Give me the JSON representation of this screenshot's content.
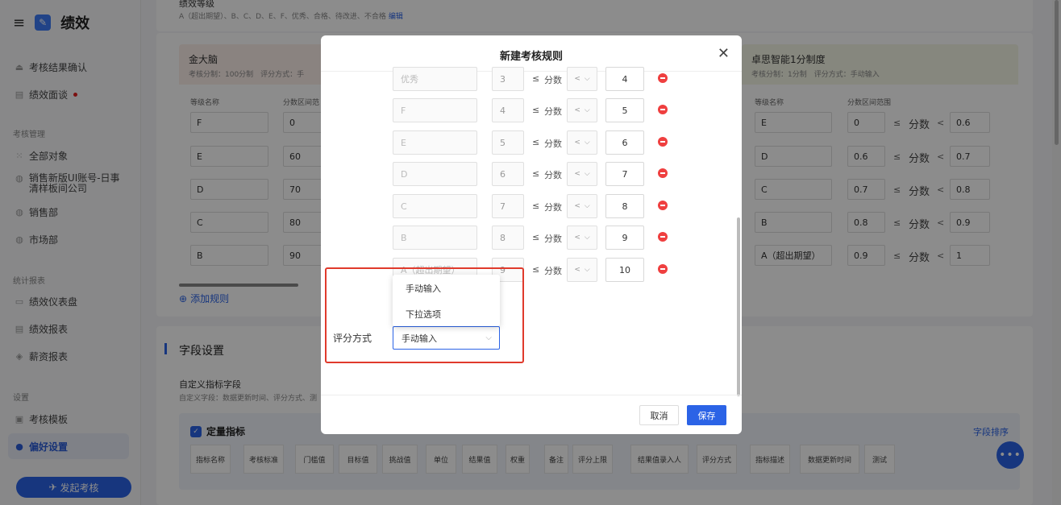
{
  "app": {
    "title": "绩效"
  },
  "sidebar": {
    "items": [
      {
        "label": "考核结果确认",
        "icon": "upload-icon"
      },
      {
        "label": "绩效面谈",
        "icon": "chat-icon"
      }
    ],
    "sections": {
      "manage": "考核管理",
      "stats": "统计报表",
      "settings": "设置"
    },
    "manage_items": [
      {
        "label": "全部对象"
      },
      {
        "label": "销售新版UI账号-日事清样板间公司"
      },
      {
        "label": "销售部"
      },
      {
        "label": "市场部"
      }
    ],
    "stats_items": [
      {
        "label": "绩效仪表盘"
      },
      {
        "label": "绩效报表"
      },
      {
        "label": "薪资报表"
      }
    ],
    "settings_items": [
      {
        "label": "考核模板"
      },
      {
        "label": "偏好设置"
      }
    ],
    "launch_button": "发起考核"
  },
  "background": {
    "grade_title": "绩效等级",
    "grade_sub": "A（超出期望）、B、C、D、E、F、优秀、合格、待改进、不合格",
    "edit_link": "编辑",
    "card_left": {
      "title": "金大脑",
      "sub": "考核分制：100分制　评分方式：手",
      "col_grade": "等级名称",
      "col_range": "分数区间范",
      "rows": [
        {
          "grade": "F",
          "lower": "0"
        },
        {
          "grade": "E",
          "lower": "60"
        },
        {
          "grade": "D",
          "lower": "70"
        },
        {
          "grade": "C",
          "lower": "80"
        },
        {
          "grade": "B",
          "lower": "90"
        }
      ]
    },
    "card_right": {
      "title": "卓思智能1分制度",
      "sub": "考核分制：1分制　评分方式：手动输入",
      "col_grade": "等级名称",
      "col_range": "分数区间范围",
      "le": "≤",
      "fen": "分数",
      "lt": "<",
      "rows": [
        {
          "grade": "E",
          "lower": "0",
          "upper": "0.6"
        },
        {
          "grade": "D",
          "lower": "0.6",
          "upper": "0.7"
        },
        {
          "grade": "C",
          "lower": "0.7",
          "upper": "0.8"
        },
        {
          "grade": "B",
          "lower": "0.8",
          "upper": "0.9"
        },
        {
          "grade": "A（超出期望）",
          "lower": "0.9",
          "upper": "1"
        }
      ]
    },
    "add_rule": "添加规则",
    "field_section": "字段设置",
    "custom_field_title": "自定义指标字段",
    "custom_field_sub": "自定义字段：数据更新时间、评分方式、测",
    "metrics_title": "定量指标",
    "sort_link": "字段排序",
    "metric_headers": [
      "指标名称",
      "考核标准",
      "门槛值",
      "目标值",
      "挑战值",
      "单位",
      "结果值",
      "权重",
      "备注",
      "评分上限",
      "结果值录入人",
      "评分方式",
      "指标描述",
      "数据更新时间",
      "测试"
    ],
    "float_button": "•••"
  },
  "modal": {
    "title": "新建考核规则",
    "close": "✕",
    "le": "≤",
    "fen": "分数",
    "op": "<",
    "rows": [
      {
        "grade": "优秀",
        "lower": "3",
        "upper": "4"
      },
      {
        "grade": "F",
        "lower": "4",
        "upper": "5"
      },
      {
        "grade": "E",
        "lower": "5",
        "upper": "6"
      },
      {
        "grade": "D",
        "lower": "6",
        "upper": "7"
      },
      {
        "grade": "C",
        "lower": "7",
        "upper": "8"
      },
      {
        "grade": "B",
        "lower": "8",
        "upper": "9"
      },
      {
        "grade": "A（超出期望）",
        "lower": "9",
        "upper": "10"
      }
    ],
    "score_method_label": "评分方式",
    "score_method_value": "手动输入",
    "dropdown_options": [
      "手动输入",
      "下拉选项"
    ],
    "cancel": "取消",
    "save": "保存"
  },
  "colors": {
    "accent": "#2b63e6",
    "danger": "#ef3f3f",
    "highlight": "#e03a2c"
  }
}
